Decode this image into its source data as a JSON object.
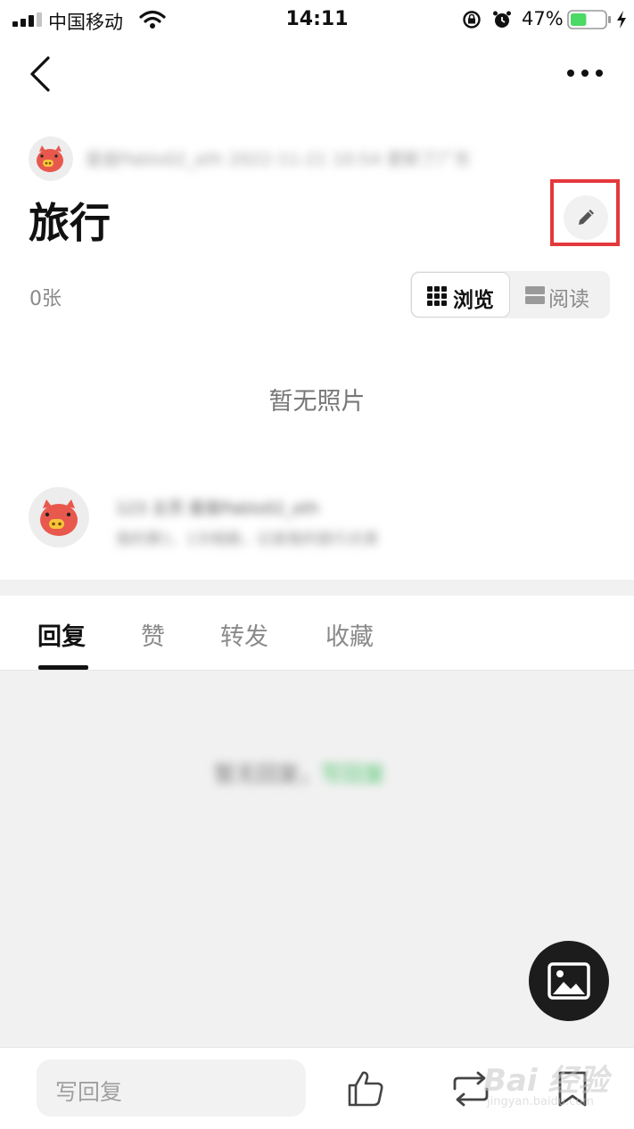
{
  "status_bar": {
    "carrier": "中国移动",
    "time": "14:11",
    "battery_percent": "47%",
    "battery_level": 0.47,
    "battery_color": "#4cd964"
  },
  "nav": {
    "back_icon": "chevron-left-icon",
    "more_icon": "more-dots-icon"
  },
  "header": {
    "author_line": "星座Pablo02_eth 2022-11-21 10:54 更新了广东",
    "title": "旅行",
    "edit_icon": "pencil-icon",
    "highlight_color": "#e4393c"
  },
  "album": {
    "photo_count": "0张",
    "view_toggle": {
      "browse_label": "浏览",
      "read_label": "阅读"
    },
    "empty_text": "暂无照片"
  },
  "owner": {
    "line1": "123 主页 星座Pablo02_eth",
    "line2": "我的第1、1次相册，记录我的旅行点滴"
  },
  "tabs": [
    {
      "label": "回复",
      "active": true
    },
    {
      "label": "赞",
      "active": false
    },
    {
      "label": "转发",
      "active": false
    },
    {
      "label": "收藏",
      "active": false
    }
  ],
  "replies": {
    "empty_text": "暂无回复，",
    "empty_link": "写回复",
    "link_color": "#4cc46a"
  },
  "fab": {
    "icon": "image-icon"
  },
  "bottom_bar": {
    "reply_placeholder": "写回复",
    "like_icon": "thumbs-up-icon",
    "repost_icon": "repost-icon",
    "favorite_icon": "bookmark-icon"
  },
  "watermark": {
    "text": "Bai 经验",
    "sub": "jingyan.baidu.com"
  }
}
